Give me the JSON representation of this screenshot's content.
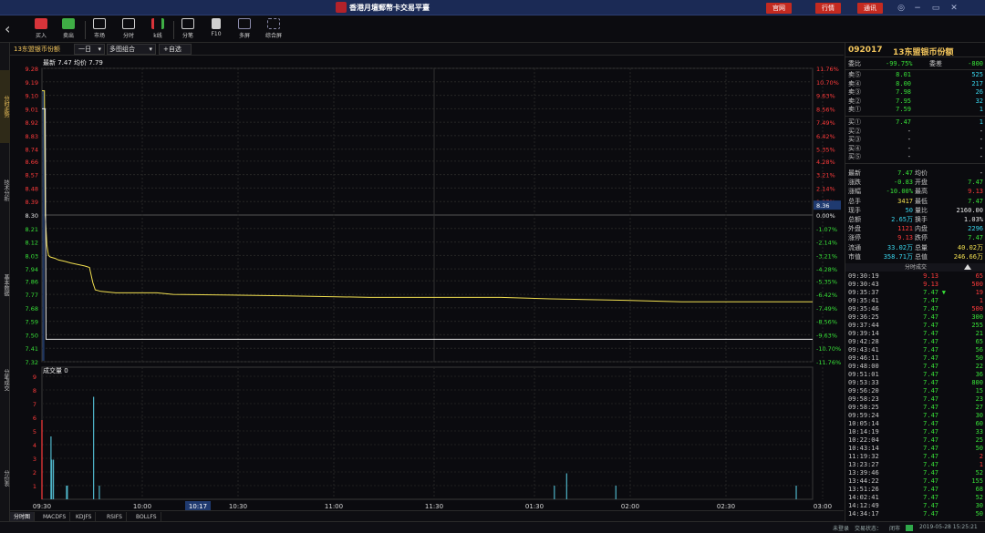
{
  "app": {
    "title": "香港月壇郵幣卡交易平臺",
    "top_buttons": [
      "官网",
      "行情",
      "通讯"
    ],
    "window_controls": [
      "◎",
      "−",
      "▭",
      "✕"
    ]
  },
  "toolbar": {
    "items": [
      {
        "label": "买入",
        "icon": "buy-icon",
        "color": "#d8343a"
      },
      {
        "label": "卖出",
        "icon": "sell-icon",
        "color": "#3fae45"
      },
      {
        "label": "市场",
        "icon": "market-icon",
        "color": "#d0d0d0"
      },
      {
        "label": "分时",
        "icon": "intraday-icon",
        "color": "#d0d0d0"
      },
      {
        "label": "k线",
        "icon": "kline-icon",
        "color": "#d8343a"
      },
      {
        "label": "分笔",
        "icon": "ticks-icon",
        "color": "#d0d0d0"
      },
      {
        "label": "F10",
        "icon": "f10-icon",
        "color": "#d0d0d0"
      },
      {
        "label": "多屏",
        "icon": "multiscreen-icon",
        "color": "#8a8aaa"
      },
      {
        "label": "综合屏",
        "icon": "dashboard-icon",
        "color": "#8a8aaa"
      }
    ]
  },
  "left_tabs": [
    "分时走势",
    "技术分析",
    "基本数据",
    "分笔成交",
    "分价表"
  ],
  "chart_header": {
    "stock_tab": "13东盟银币份额",
    "period": "一日",
    "multi": "多图组合",
    "add_fav": "+自选"
  },
  "bottom_tabs": [
    "分时图",
    "MACDFS",
    "KDJFS",
    "RSIFS",
    "BOLLFS"
  ],
  "chart_data": [
    {
      "type": "line",
      "legend": "最新 7.47  均价 7.79",
      "x_ticks": [
        "09:30",
        "10:00",
        "10:17",
        "10:30",
        "11:00",
        "11:30",
        "01:30",
        "02:00",
        "02:30",
        "03:00"
      ],
      "highlight_tick": "10:17",
      "y_ticks": [
        9.28,
        9.19,
        9.1,
        9.01,
        8.92,
        8.83,
        8.74,
        8.66,
        8.57,
        8.48,
        8.39,
        8.3,
        8.21,
        8.12,
        8.03,
        7.94,
        7.86,
        7.77,
        7.68,
        7.59,
        7.5,
        7.41,
        7.32
      ],
      "y_pct_ticks": [
        "11.76%",
        "10.70%",
        "9.63%",
        "8.56%",
        "7.49%",
        "6.42%",
        "5.35%",
        "4.28%",
        "3.21%",
        "2.14%",
        "1.07%",
        "0.00%",
        "-1.07%",
        "-2.14%",
        "-3.21%",
        "-4.28%",
        "-5.35%",
        "-6.42%",
        "-7.49%",
        "-8.56%",
        "-9.63%",
        "-10.70%",
        "-11.76%"
      ],
      "ylim": [
        7.32,
        9.28
      ],
      "prev_close": 8.3,
      "cursor_value": "8.36",
      "series": [
        {
          "name": "最新",
          "points": [
            [
              0,
              9.13
            ],
            [
              1,
              9.13
            ],
            [
              3,
              9.13
            ],
            [
              4,
              8.3
            ],
            [
              6,
              8.1
            ],
            [
              8,
              8.03
            ],
            [
              10,
              8.02
            ],
            [
              16,
              8.01
            ],
            [
              20,
              8.0
            ],
            [
              28,
              7.99
            ],
            [
              35,
              7.98
            ],
            [
              52,
              7.96
            ],
            [
              58,
              7.95
            ],
            [
              62,
              7.85
            ],
            [
              65,
              7.8
            ],
            [
              72,
              7.79
            ],
            [
              90,
              7.78
            ],
            [
              140,
              7.78
            ],
            [
              160,
              7.77
            ],
            [
              300,
              7.76
            ],
            [
              400,
              7.75
            ],
            [
              560,
              7.75
            ],
            [
              620,
              7.74
            ],
            [
              712,
              7.73
            ],
            [
              780,
              7.72
            ],
            [
              940,
              7.72
            ]
          ]
        },
        {
          "name": "均价",
          "points": [
            [
              0,
              9.01
            ],
            [
              4,
              9.01
            ],
            [
              5,
              7.47
            ],
            [
              940,
              7.47
            ]
          ]
        }
      ]
    },
    {
      "type": "bar",
      "legend": "成交量 0",
      "y_ticks": [
        9,
        8,
        7,
        6,
        5,
        4,
        3,
        2,
        1
      ],
      "ylim": [
        0,
        9
      ],
      "bars": [
        [
          0,
          5.8
        ],
        [
          11,
          4.6
        ],
        [
          12,
          2.9
        ],
        [
          14,
          2.9
        ],
        [
          30,
          1.0
        ],
        [
          31,
          1.0
        ],
        [
          63,
          7.5
        ],
        [
          70,
          1.0
        ],
        [
          625,
          1.0
        ],
        [
          640,
          1.9
        ],
        [
          700,
          1.0
        ],
        [
          920,
          1.0
        ]
      ]
    }
  ],
  "quote": {
    "code": "092017",
    "name": "13东盟银币份额",
    "weibi_label": "委比",
    "weibi": "-99.75%",
    "weicha_label": "委差",
    "weicha": "-800",
    "asks": [
      {
        "label": "卖⑤",
        "price": "8.01",
        "vol": "525"
      },
      {
        "label": "卖④",
        "price": "8.00",
        "vol": "217"
      },
      {
        "label": "卖③",
        "price": "7.98",
        "vol": "26"
      },
      {
        "label": "卖②",
        "price": "7.95",
        "vol": "32"
      },
      {
        "label": "卖①",
        "price": "7.59",
        "vol": "1"
      }
    ],
    "bids": [
      {
        "label": "买①",
        "price": "7.47",
        "vol": "1"
      },
      {
        "label": "买②",
        "price": "-",
        "vol": "-"
      },
      {
        "label": "买③",
        "price": "-",
        "vol": "-"
      },
      {
        "label": "买④",
        "price": "-",
        "vol": "-"
      },
      {
        "label": "买⑤",
        "price": "-",
        "vol": "-"
      }
    ],
    "stats": [
      {
        "l1": "最新",
        "v1": "7.47",
        "c1": "green",
        "l2": "均价",
        "v2": "-",
        "c2": "white"
      },
      {
        "l1": "涨跌",
        "v1": "-0.83",
        "c1": "green",
        "l2": "开盘",
        "v2": "7.47",
        "c2": "green"
      },
      {
        "l1": "涨幅",
        "v1": "-10.00%",
        "c1": "green",
        "l2": "最高",
        "v2": "9.13",
        "c2": "red"
      },
      {
        "l1": "总手",
        "v1": "3417",
        "c1": "yellow",
        "l2": "最低",
        "v2": "7.47",
        "c2": "green"
      },
      {
        "l1": "现手",
        "v1": "50",
        "c1": "cyan",
        "l2": "量比",
        "v2": "2160.00",
        "c2": "white"
      },
      {
        "l1": "总额",
        "v1": "2.65万",
        "c1": "cyan",
        "l2": "换手",
        "v2": "1.03%",
        "c2": "white"
      },
      {
        "l1": "外盘",
        "v1": "1121",
        "c1": "red",
        "l2": "内盘",
        "v2": "2296",
        "c2": "cyan"
      },
      {
        "l1": "涨停",
        "v1": "9.13",
        "c1": "red",
        "l2": "跌停",
        "v2": "7.47",
        "c2": "green"
      },
      {
        "l1": "流通",
        "v1": "33.02万",
        "c1": "cyan",
        "l2": "总量",
        "v2": "40.02万",
        "c2": "yellow"
      },
      {
        "l1": "市值",
        "v1": "358.71万",
        "c1": "cyan",
        "l2": "总值",
        "v2": "246.66万",
        "c2": "yellow"
      }
    ],
    "trades_title": "分时成交",
    "trades": [
      {
        "t": "09:30:19",
        "p": "9.13",
        "pc": "red",
        "v": "65",
        "vc": "red"
      },
      {
        "t": "09:30:43",
        "p": "9.13",
        "pc": "red",
        "v": "500",
        "vc": "red"
      },
      {
        "t": "09:35:37",
        "p": "7.47",
        "pc": "green",
        "v": "19",
        "vc": "red",
        "arrow": "▼"
      },
      {
        "t": "09:35:41",
        "p": "7.47",
        "pc": "green",
        "v": "1",
        "vc": "red"
      },
      {
        "t": "09:35:46",
        "p": "7.47",
        "pc": "green",
        "v": "500",
        "vc": "red"
      },
      {
        "t": "09:36:25",
        "p": "7.47",
        "pc": "green",
        "v": "300",
        "vc": "green"
      },
      {
        "t": "09:37:44",
        "p": "7.47",
        "pc": "green",
        "v": "255",
        "vc": "green"
      },
      {
        "t": "09:39:14",
        "p": "7.47",
        "pc": "green",
        "v": "21",
        "vc": "green"
      },
      {
        "t": "09:42:28",
        "p": "7.47",
        "pc": "green",
        "v": "65",
        "vc": "green"
      },
      {
        "t": "09:43:41",
        "p": "7.47",
        "pc": "green",
        "v": "56",
        "vc": "green"
      },
      {
        "t": "09:46:11",
        "p": "7.47",
        "pc": "green",
        "v": "50",
        "vc": "green"
      },
      {
        "t": "09:48:00",
        "p": "7.47",
        "pc": "green",
        "v": "22",
        "vc": "green"
      },
      {
        "t": "09:51:01",
        "p": "7.47",
        "pc": "green",
        "v": "36",
        "vc": "green"
      },
      {
        "t": "09:53:33",
        "p": "7.47",
        "pc": "green",
        "v": "800",
        "vc": "green"
      },
      {
        "t": "09:56:20",
        "p": "7.47",
        "pc": "green",
        "v": "15",
        "vc": "green"
      },
      {
        "t": "09:58:23",
        "p": "7.47",
        "pc": "green",
        "v": "23",
        "vc": "green"
      },
      {
        "t": "09:58:25",
        "p": "7.47",
        "pc": "green",
        "v": "27",
        "vc": "green"
      },
      {
        "t": "09:59:24",
        "p": "7.47",
        "pc": "green",
        "v": "30",
        "vc": "green"
      },
      {
        "t": "10:05:14",
        "p": "7.47",
        "pc": "green",
        "v": "60",
        "vc": "green"
      },
      {
        "t": "10:14:19",
        "p": "7.47",
        "pc": "green",
        "v": "33",
        "vc": "green"
      },
      {
        "t": "10:22:04",
        "p": "7.47",
        "pc": "green",
        "v": "25",
        "vc": "green"
      },
      {
        "t": "10:43:14",
        "p": "7.47",
        "pc": "green",
        "v": "50",
        "vc": "green"
      },
      {
        "t": "11:19:32",
        "p": "7.47",
        "pc": "green",
        "v": "2",
        "vc": "red"
      },
      {
        "t": "13:23:27",
        "p": "7.47",
        "pc": "green",
        "v": "1",
        "vc": "red"
      },
      {
        "t": "13:39:46",
        "p": "7.47",
        "pc": "green",
        "v": "52",
        "vc": "green"
      },
      {
        "t": "13:44:22",
        "p": "7.47",
        "pc": "green",
        "v": "155",
        "vc": "green"
      },
      {
        "t": "13:51:26",
        "p": "7.47",
        "pc": "green",
        "v": "68",
        "vc": "green"
      },
      {
        "t": "14:02:41",
        "p": "7.47",
        "pc": "green",
        "v": "52",
        "vc": "green"
      },
      {
        "t": "14:12:49",
        "p": "7.47",
        "pc": "green",
        "v": "30",
        "vc": "green"
      },
      {
        "t": "14:34:17",
        "p": "7.47",
        "pc": "green",
        "v": "50",
        "vc": "green"
      }
    ]
  },
  "statusbar": {
    "login": "未登录",
    "conn_label": "交易状态：",
    "conn": "闭市",
    "datetime": "2019-05-28 15:25:21"
  },
  "colors": {
    "up": "#ff3b3b",
    "down": "#38e038",
    "price_line": "#f2e050",
    "avg_line": "#e8e8e8",
    "volume": "#4fb4c8",
    "accent": "#f2c55c"
  }
}
